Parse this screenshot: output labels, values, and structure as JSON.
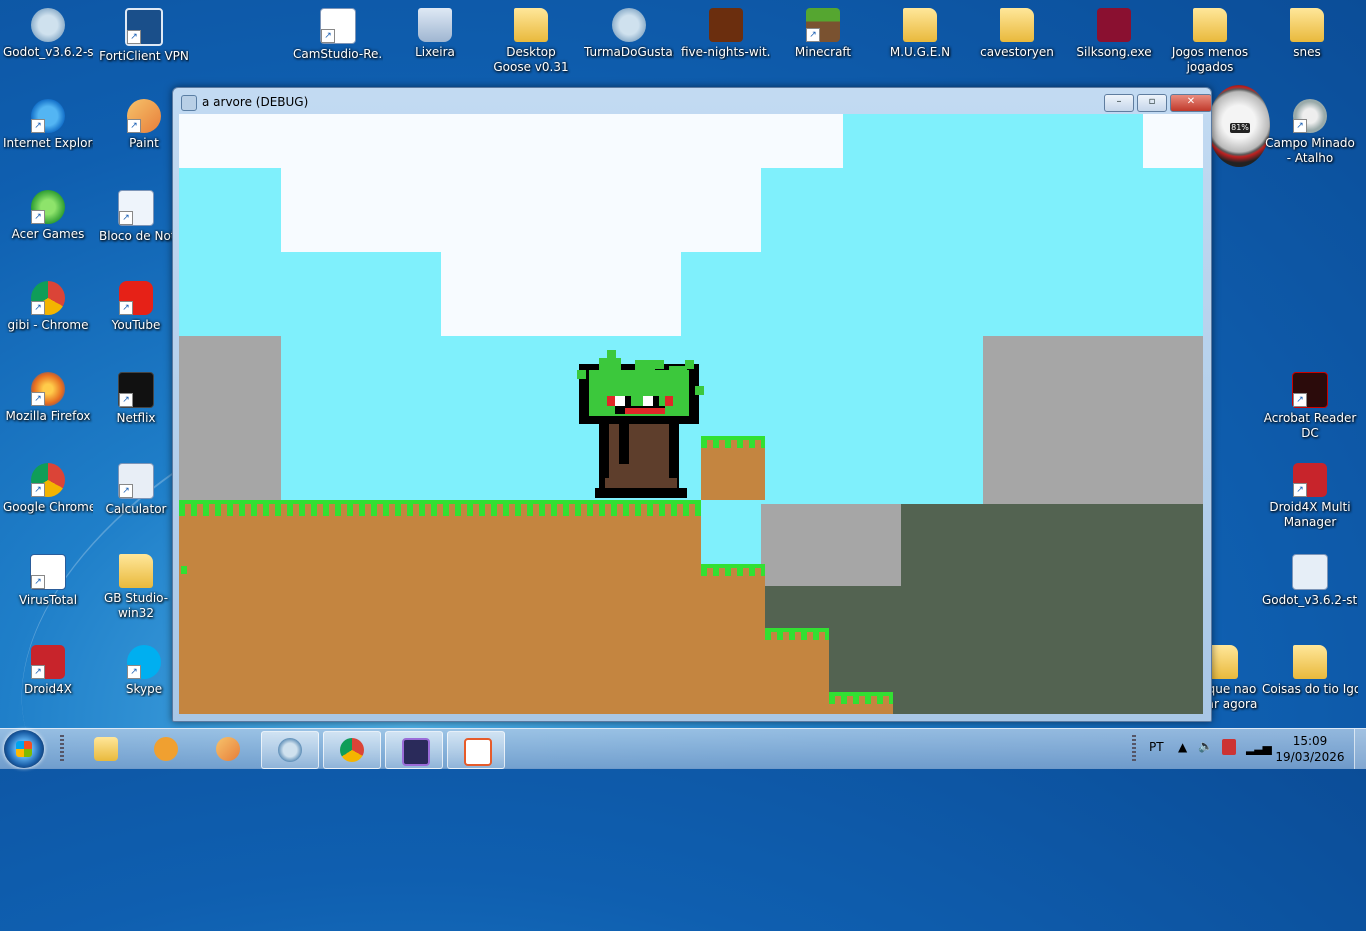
{
  "desktop": {
    "icons": [
      {
        "label": "Godot_v3.6.2-s..."
      },
      {
        "label": "FortiClient VPN"
      },
      {
        "label": "CamStudio-Re..."
      },
      {
        "label": "Lixeira"
      },
      {
        "label": "Desktop Goose v0.31"
      },
      {
        "label": "TurmaDoGusta..."
      },
      {
        "label": "five-nights-wit..."
      },
      {
        "label": "Minecraft"
      },
      {
        "label": "M.U.G.E.N"
      },
      {
        "label": "cavestoryen"
      },
      {
        "label": "Silksong.exe"
      },
      {
        "label": "Jogos menos jogados"
      },
      {
        "label": "snes"
      },
      {
        "label": "Internet Explorer"
      },
      {
        "label": "Paint"
      },
      {
        "label": "Acer Games"
      },
      {
        "label": "Bloco de Not"
      },
      {
        "label": "gibi - Chrome"
      },
      {
        "label": "YouTube"
      },
      {
        "label": "Mozilla Firefox"
      },
      {
        "label": "Netflix"
      },
      {
        "label": "Google Chrome"
      },
      {
        "label": "Calculator"
      },
      {
        "label": "VirusTotal"
      },
      {
        "label": "GB Studio-win32"
      },
      {
        "label": "Droid4X"
      },
      {
        "label": "Skype"
      },
      {
        "label": "Campo Minado - Atalho"
      },
      {
        "label": "Acrobat Reader DC"
      },
      {
        "label": "Droid4X Multi Manager"
      },
      {
        "label": "Godot_v3.6.2-st..."
      },
      {
        "label": "que nao ar agora"
      },
      {
        "label": "Coisas do tio Igor"
      }
    ],
    "gadget_percent": "81%"
  },
  "window": {
    "title": "a arvore (DEBUG)",
    "min_glyph": "–",
    "max_glyph": "▫",
    "close_glyph": "✕"
  },
  "colors": {
    "sky": "#7ff0fc",
    "cloud": "#f7fbff",
    "stone": "#a6a6a6",
    "dark_stone": "#536351",
    "dirt": "#c48540",
    "grass": "#32e032",
    "trunk": "#5e3e2c",
    "leaf": "#3cc83c",
    "outline": "#000000",
    "mouth": "#e02828"
  },
  "taskbar": {
    "language": "PT",
    "time": "15:09",
    "date": "19/03/2026"
  }
}
